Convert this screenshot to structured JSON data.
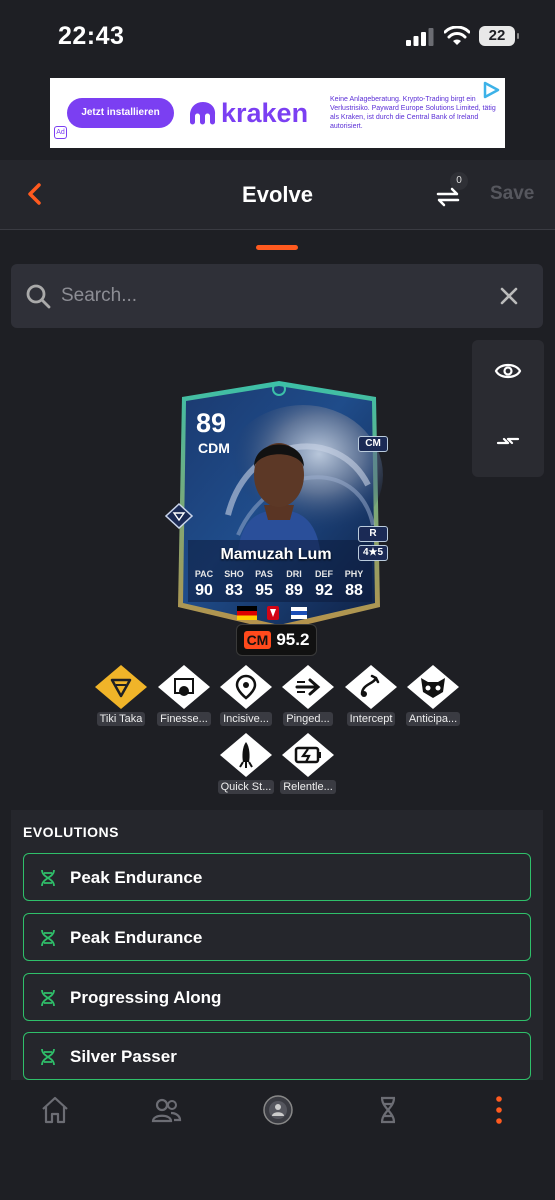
{
  "status_bar": {
    "time": "22:43",
    "battery": "22"
  },
  "ad": {
    "button": "Jetzt installieren",
    "brand": "kraken",
    "disclaimer": "Keine Anlageberatung. Krypto-Trading birgt ein Verlustrisiko. Payward Europe Solutions Limited, tätig als Kraken, ist durch die Central Bank of Ireland autorisiert."
  },
  "header": {
    "title": "Evolve",
    "compare_count": "0",
    "save_label": "Save"
  },
  "search": {
    "placeholder": "Search..."
  },
  "card": {
    "rating": "89",
    "position": "CDM",
    "alt_position": "CM",
    "foot": "R",
    "skills_weak": "4★5",
    "name": "Mamuzah Lum",
    "stats": [
      {
        "label": "PAC",
        "value": "90"
      },
      {
        "label": "SHO",
        "value": "83"
      },
      {
        "label": "PAS",
        "value": "95"
      },
      {
        "label": "DRI",
        "value": "89"
      },
      {
        "label": "DEF",
        "value": "92"
      },
      {
        "label": "PHY",
        "value": "88"
      }
    ],
    "chem_position": "CM",
    "chem_value": "95.2"
  },
  "playstyles": [
    {
      "label": "Tiki Taka",
      "icon": "tiki-taka-icon",
      "plus": true
    },
    {
      "label": "Finesse...",
      "icon": "finesse-shot-icon",
      "plus": false
    },
    {
      "label": "Incisive...",
      "icon": "incisive-pass-icon",
      "plus": false
    },
    {
      "label": "Pinged...",
      "icon": "pinged-pass-icon",
      "plus": false
    },
    {
      "label": "Intercept",
      "icon": "intercept-icon",
      "plus": false
    },
    {
      "label": "Anticipa...",
      "icon": "anticipate-icon",
      "plus": false
    },
    {
      "label": "Quick St...",
      "icon": "quick-step-icon",
      "plus": false
    },
    {
      "label": "Relentle...",
      "icon": "relentless-icon",
      "plus": false
    }
  ],
  "evolutions": {
    "title": "EVOLUTIONS",
    "items": [
      {
        "label": "Peak Endurance"
      },
      {
        "label": "Peak Endurance"
      },
      {
        "label": "Progressing Along"
      },
      {
        "label": "Silver Passer"
      }
    ]
  },
  "colors": {
    "accent": "#ff5a1f",
    "evo_border": "#2fbf6a",
    "bg": "#1e1f24",
    "gold": "#f0b429"
  },
  "nav": [
    "home-icon",
    "squad-icon",
    "club-icon",
    "evolutions-icon",
    "more-icon"
  ]
}
